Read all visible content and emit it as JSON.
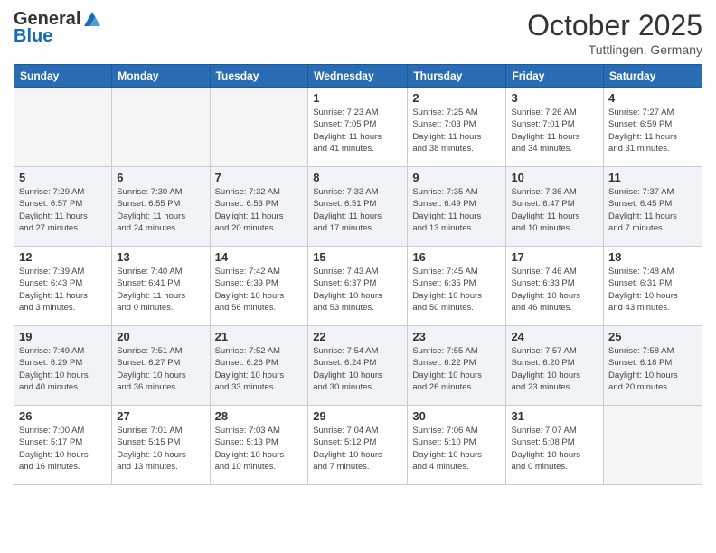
{
  "logo": {
    "general": "General",
    "blue": "Blue"
  },
  "title": "October 2025",
  "location": "Tuttlingen, Germany",
  "days_of_week": [
    "Sunday",
    "Monday",
    "Tuesday",
    "Wednesday",
    "Thursday",
    "Friday",
    "Saturday"
  ],
  "weeks": [
    [
      {
        "day": "",
        "info": ""
      },
      {
        "day": "",
        "info": ""
      },
      {
        "day": "",
        "info": ""
      },
      {
        "day": "1",
        "info": "Sunrise: 7:23 AM\nSunset: 7:05 PM\nDaylight: 11 hours\nand 41 minutes."
      },
      {
        "day": "2",
        "info": "Sunrise: 7:25 AM\nSunset: 7:03 PM\nDaylight: 11 hours\nand 38 minutes."
      },
      {
        "day": "3",
        "info": "Sunrise: 7:26 AM\nSunset: 7:01 PM\nDaylight: 11 hours\nand 34 minutes."
      },
      {
        "day": "4",
        "info": "Sunrise: 7:27 AM\nSunset: 6:59 PM\nDaylight: 11 hours\nand 31 minutes."
      }
    ],
    [
      {
        "day": "5",
        "info": "Sunrise: 7:29 AM\nSunset: 6:57 PM\nDaylight: 11 hours\nand 27 minutes."
      },
      {
        "day": "6",
        "info": "Sunrise: 7:30 AM\nSunset: 6:55 PM\nDaylight: 11 hours\nand 24 minutes."
      },
      {
        "day": "7",
        "info": "Sunrise: 7:32 AM\nSunset: 6:53 PM\nDaylight: 11 hours\nand 20 minutes."
      },
      {
        "day": "8",
        "info": "Sunrise: 7:33 AM\nSunset: 6:51 PM\nDaylight: 11 hours\nand 17 minutes."
      },
      {
        "day": "9",
        "info": "Sunrise: 7:35 AM\nSunset: 6:49 PM\nDaylight: 11 hours\nand 13 minutes."
      },
      {
        "day": "10",
        "info": "Sunrise: 7:36 AM\nSunset: 6:47 PM\nDaylight: 11 hours\nand 10 minutes."
      },
      {
        "day": "11",
        "info": "Sunrise: 7:37 AM\nSunset: 6:45 PM\nDaylight: 11 hours\nand 7 minutes."
      }
    ],
    [
      {
        "day": "12",
        "info": "Sunrise: 7:39 AM\nSunset: 6:43 PM\nDaylight: 11 hours\nand 3 minutes."
      },
      {
        "day": "13",
        "info": "Sunrise: 7:40 AM\nSunset: 6:41 PM\nDaylight: 11 hours\nand 0 minutes."
      },
      {
        "day": "14",
        "info": "Sunrise: 7:42 AM\nSunset: 6:39 PM\nDaylight: 10 hours\nand 56 minutes."
      },
      {
        "day": "15",
        "info": "Sunrise: 7:43 AM\nSunset: 6:37 PM\nDaylight: 10 hours\nand 53 minutes."
      },
      {
        "day": "16",
        "info": "Sunrise: 7:45 AM\nSunset: 6:35 PM\nDaylight: 10 hours\nand 50 minutes."
      },
      {
        "day": "17",
        "info": "Sunrise: 7:46 AM\nSunset: 6:33 PM\nDaylight: 10 hours\nand 46 minutes."
      },
      {
        "day": "18",
        "info": "Sunrise: 7:48 AM\nSunset: 6:31 PM\nDaylight: 10 hours\nand 43 minutes."
      }
    ],
    [
      {
        "day": "19",
        "info": "Sunrise: 7:49 AM\nSunset: 6:29 PM\nDaylight: 10 hours\nand 40 minutes."
      },
      {
        "day": "20",
        "info": "Sunrise: 7:51 AM\nSunset: 6:27 PM\nDaylight: 10 hours\nand 36 minutes."
      },
      {
        "day": "21",
        "info": "Sunrise: 7:52 AM\nSunset: 6:26 PM\nDaylight: 10 hours\nand 33 minutes."
      },
      {
        "day": "22",
        "info": "Sunrise: 7:54 AM\nSunset: 6:24 PM\nDaylight: 10 hours\nand 30 minutes."
      },
      {
        "day": "23",
        "info": "Sunrise: 7:55 AM\nSunset: 6:22 PM\nDaylight: 10 hours\nand 26 minutes."
      },
      {
        "day": "24",
        "info": "Sunrise: 7:57 AM\nSunset: 6:20 PM\nDaylight: 10 hours\nand 23 minutes."
      },
      {
        "day": "25",
        "info": "Sunrise: 7:58 AM\nSunset: 6:18 PM\nDaylight: 10 hours\nand 20 minutes."
      }
    ],
    [
      {
        "day": "26",
        "info": "Sunrise: 7:00 AM\nSunset: 5:17 PM\nDaylight: 10 hours\nand 16 minutes."
      },
      {
        "day": "27",
        "info": "Sunrise: 7:01 AM\nSunset: 5:15 PM\nDaylight: 10 hours\nand 13 minutes."
      },
      {
        "day": "28",
        "info": "Sunrise: 7:03 AM\nSunset: 5:13 PM\nDaylight: 10 hours\nand 10 minutes."
      },
      {
        "day": "29",
        "info": "Sunrise: 7:04 AM\nSunset: 5:12 PM\nDaylight: 10 hours\nand 7 minutes."
      },
      {
        "day": "30",
        "info": "Sunrise: 7:06 AM\nSunset: 5:10 PM\nDaylight: 10 hours\nand 4 minutes."
      },
      {
        "day": "31",
        "info": "Sunrise: 7:07 AM\nSunset: 5:08 PM\nDaylight: 10 hours\nand 0 minutes."
      },
      {
        "day": "",
        "info": ""
      }
    ]
  ]
}
